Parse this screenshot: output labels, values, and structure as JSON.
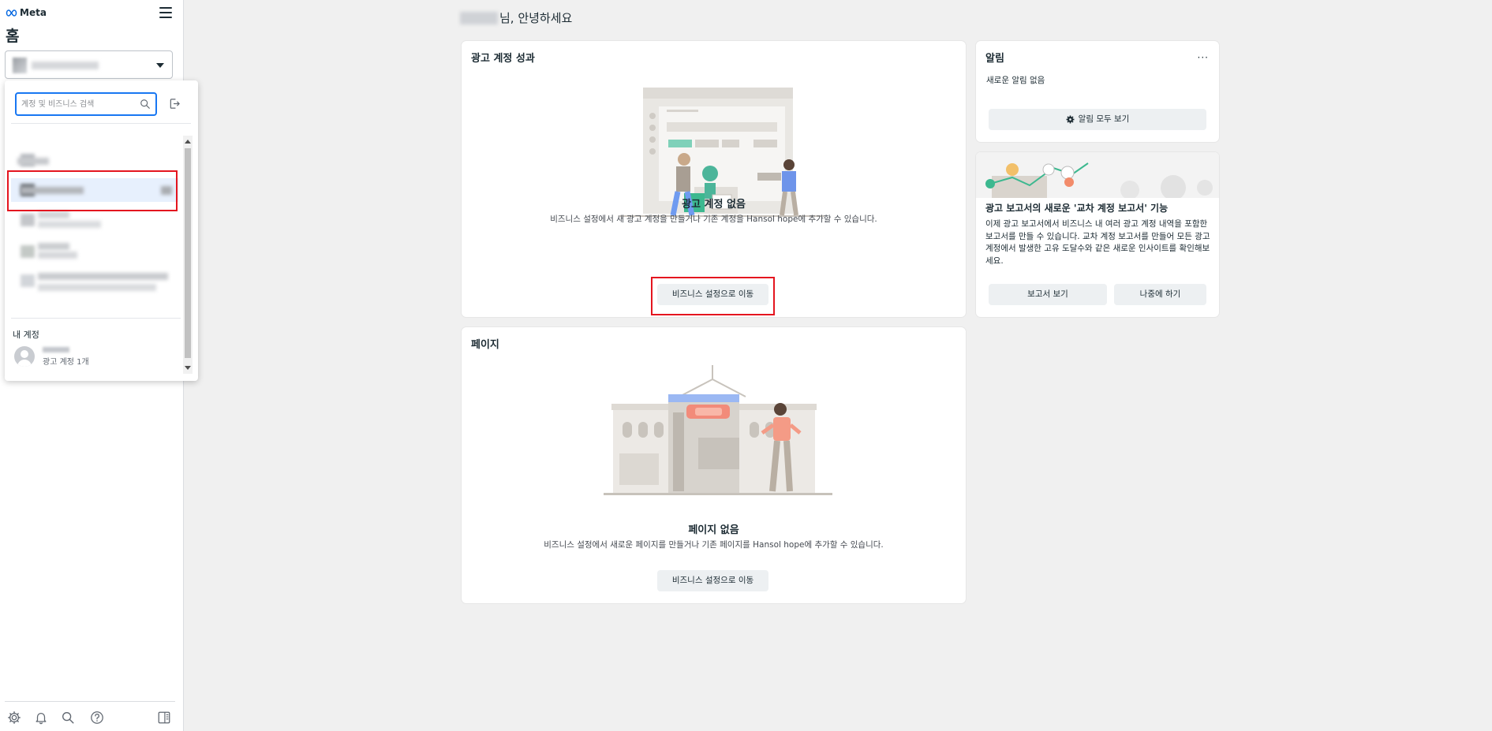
{
  "app": {
    "brand": "Meta"
  },
  "sidebar": {
    "title": "홈",
    "bottom_icons": [
      "settings-icon",
      "bell-icon",
      "search-icon",
      "help-icon",
      "panel-toggle-icon"
    ]
  },
  "account_dropdown": {
    "search_placeholder": "계정 및 비즈니스 검색",
    "my_account_label": "내 계정",
    "my_account_sub": "광고 계정 1개"
  },
  "main": {
    "greeting_suffix": "님, 안녕하세요"
  },
  "ad_card": {
    "title": "광고 계정 성과",
    "empty_title": "광고 계정 없음",
    "empty_desc": "비즈니스 설정에서 새 광고 계정을 만들거나 기존 계정을 Hansol hope에 추가할 수 있습니다.",
    "button": "비즈니스 설정으로 이동"
  },
  "pages_card": {
    "title": "페이지",
    "empty_title": "페이지 없음",
    "empty_desc": "비즈니스 설정에서 새로운 페이지를 만들거나 기존 페이지를 Hansol hope에 추가할 수 있습니다.",
    "button": "비즈니스 설정으로 이동"
  },
  "notifications": {
    "title": "알림",
    "more": "···",
    "empty": "새로운 알림 없음",
    "view_all": "알림 모두 보기"
  },
  "promo": {
    "title": "광고 보고서의 새로운 '교차 계정 보고서' 기능",
    "desc": "이제 광고 보고서에서 비즈니스 내 여러 광고 계정 내역을 포함한 보고서를 만들 수 있습니다. 교차 계정 보고서를 만들어 모든 광고 계정에서 발생한 고유 도달수와 같은 새로운 인사이트를 확인해보세요.",
    "view_report": "보고서 보기",
    "later": "나중에 하기"
  },
  "colors": {
    "accent": "#1877f2",
    "highlight_box": "#e4151f",
    "selected_row": "#e7f0fd"
  }
}
